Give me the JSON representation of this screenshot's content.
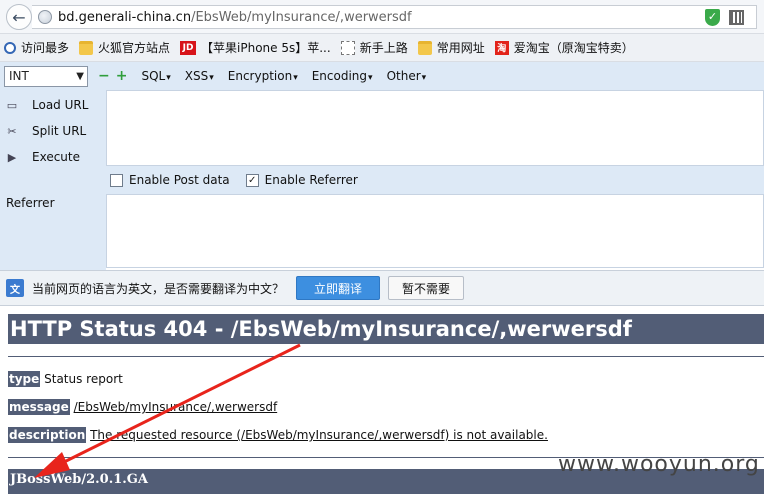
{
  "browser": {
    "url_host": "bd.generali-china.cn",
    "url_path": "/EbsWeb/myInsurance/,werwersdf"
  },
  "bookmarks": [
    {
      "icon": "search-icon",
      "label": "访问最多"
    },
    {
      "icon": "folder-icon",
      "label": "火狐官方站点"
    },
    {
      "icon": "jd-icon",
      "icon_text": "JD",
      "label": "【苹果iPhone 5s】苹..."
    },
    {
      "icon": "page-icon",
      "label": "新手上路"
    },
    {
      "icon": "folder-icon",
      "label": "常用网址"
    },
    {
      "icon": "taobao-icon",
      "icon_text": "淘",
      "label": "爱淘宝（原淘宝特卖）"
    }
  ],
  "hackbar": {
    "type_select": "INT",
    "menus": [
      "SQL",
      "XSS",
      "Encryption",
      "Encoding",
      "Other"
    ],
    "actions": {
      "load": "Load URL",
      "split": "Split URL",
      "execute": "Execute"
    },
    "enable_post": "Enable Post data",
    "enable_post_checked": false,
    "enable_referrer": "Enable Referrer",
    "enable_referrer_checked": true,
    "referrer_label": "Referrer"
  },
  "translate": {
    "message": "当前网页的语言为英文，是否需要翻译为中文？",
    "translate_btn": "立即翻译",
    "dismiss_btn": "暂不需要"
  },
  "page": {
    "heading": "HTTP Status 404 - /EbsWeb/myInsurance/,werwersdf",
    "type_label": "type",
    "type_value": "Status report",
    "message_label": "message",
    "message_value": "/EbsWeb/myInsurance/,werwersdf",
    "description_label": "description",
    "description_value": "The requested resource (/EbsWeb/myInsurance/,werwersdf) is not available.",
    "footer": "JBossWeb/2.0.1.GA"
  },
  "watermark": "www.wooyun.org",
  "colors": {
    "heading_bg": "#525d76",
    "annotation_arrow": "#e8241c",
    "hackbar_bg": "#dde9f6"
  }
}
